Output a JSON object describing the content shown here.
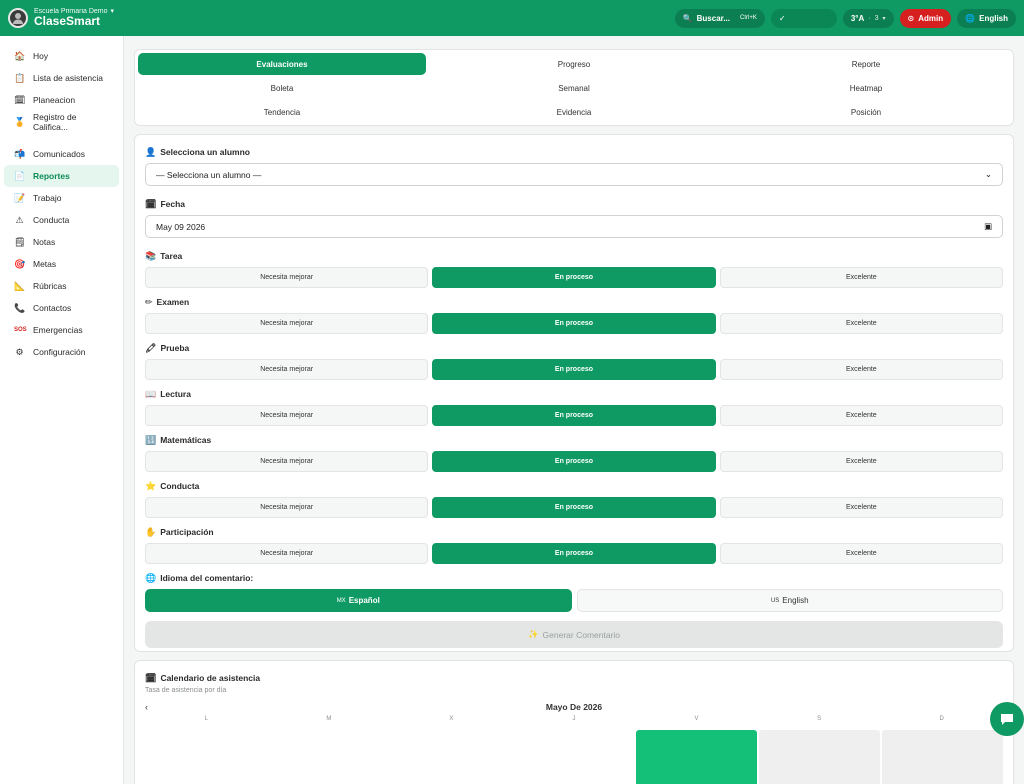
{
  "header": {
    "school": "Escuela Primaria Demo",
    "app_name": "ClaseSmart",
    "search_label": "Buscar...",
    "search_shortcut": "Ctrl+K",
    "status_check": "✓",
    "group_label": "3°A",
    "group_count": "3",
    "admin_label": "Admin",
    "language_label": "English",
    "colors": {
      "brand": "#0e9a62",
      "admin": "#d61f1f"
    }
  },
  "sidebar": {
    "items": [
      {
        "label": "Hoy",
        "icon": "house-icon"
      },
      {
        "label": "Lista de asistencia",
        "icon": "clipboard-icon"
      },
      {
        "label": "Planeacion",
        "icon": "calendar-icon"
      },
      {
        "label": "Registro de Califica...",
        "icon": "medal-icon"
      },
      {
        "label": "Comunicados",
        "icon": "mailbox-icon"
      },
      {
        "label": "Reportes",
        "icon": "report-icon"
      },
      {
        "label": "Trabajo",
        "icon": "document-icon"
      },
      {
        "label": "Conducta",
        "icon": "warning-icon"
      },
      {
        "label": "Notas",
        "icon": "note-icon"
      },
      {
        "label": "Metas",
        "icon": "target-icon"
      },
      {
        "label": "Rúbricas",
        "icon": "ruler-icon"
      },
      {
        "label": "Contactos",
        "icon": "phone-icon"
      },
      {
        "label": "Emergencias",
        "icon": "sos-icon"
      },
      {
        "label": "Configuración",
        "icon": "gear-icon"
      }
    ],
    "active": "Reportes"
  },
  "tabs": [
    "Evaluaciones",
    "Progreso",
    "Reporte",
    "Boleta",
    "Semanal",
    "Heatmap",
    "Tendencia",
    "Evidencia",
    "Posición"
  ],
  "active_tab": "Evaluaciones",
  "form": {
    "student_label": "Selecciona un alumno",
    "student_value": "— Selecciona un alumno —",
    "date_label": "Fecha",
    "date_value": "May 09 2026",
    "rating_options": [
      "Necesita mejorar",
      "En proceso",
      "Excelente"
    ],
    "selected_rating": "En proceso",
    "criteria": [
      {
        "label": "Tarea",
        "icon": "books-icon"
      },
      {
        "label": "Examen",
        "icon": "pencil-icon"
      },
      {
        "label": "Prueba",
        "icon": "crayon-icon"
      },
      {
        "label": "Lectura",
        "icon": "open-book-icon"
      },
      {
        "label": "Matemáticas",
        "icon": "numbers-icon"
      },
      {
        "label": "Conducta",
        "icon": "star-icon"
      },
      {
        "label": "Participación",
        "icon": "hand-icon"
      }
    ],
    "comment_language_label": "Idioma del comentario:",
    "languages": [
      {
        "code": "MX",
        "label": "Español",
        "selected": true
      },
      {
        "code": "US",
        "label": "English",
        "selected": false
      }
    ],
    "generate_label": "Generar Comentario"
  },
  "calendar": {
    "title": "Calendario de asistencia",
    "subtitle": "Tasa de asistencia por día",
    "month": "Mayo De 2026",
    "prev_symbol": "‹",
    "weekdays": [
      "L",
      "M",
      "X",
      "J",
      "V",
      "S",
      "D"
    ],
    "first_row_states": [
      "empty",
      "empty",
      "empty",
      "empty",
      "present",
      "weekend",
      "weekend"
    ]
  }
}
